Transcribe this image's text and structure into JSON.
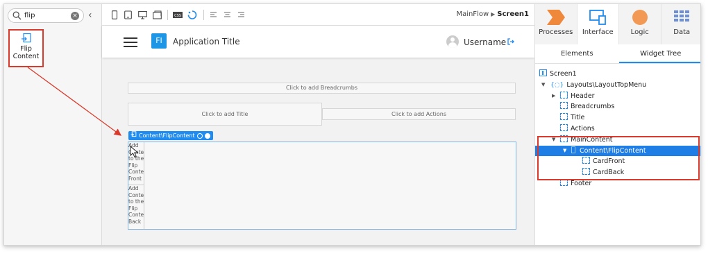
{
  "search": {
    "value": "flip"
  },
  "widget_result": {
    "label_line1": "Flip",
    "label_line2": "Content"
  },
  "toolbar": {
    "flow_name": "MainFlow",
    "screen_name": "Screen1"
  },
  "app": {
    "logo_text": "FI",
    "title": "Application Title",
    "username": "Username"
  },
  "canvas": {
    "breadcrumbs_placeholder": "Click to add Breadcrumbs",
    "title_placeholder": "Click to add Title",
    "actions_placeholder": "Click to add Actions",
    "selected_widget_tag": "Content\\FlipContent",
    "flip_front_text": "Add\nContent\nto the\nFlip\nContent\nFront",
    "flip_back_text": "Add\nContent\nto the\nFlip\nContent\nBack"
  },
  "right_tabs": [
    {
      "label": "Processes",
      "icon": "processes-icon"
    },
    {
      "label": "Interface",
      "icon": "interface-icon"
    },
    {
      "label": "Logic",
      "icon": "logic-icon"
    },
    {
      "label": "Data",
      "icon": "data-icon"
    }
  ],
  "sub_tabs": {
    "elements": "Elements",
    "widget_tree": "Widget Tree"
  },
  "tree": [
    {
      "label": "Screen1"
    },
    {
      "label": "Layouts\\LayoutTopMenu"
    },
    {
      "label": "Header"
    },
    {
      "label": "Breadcrumbs"
    },
    {
      "label": "Title"
    },
    {
      "label": "Actions"
    },
    {
      "label": "MainContent"
    },
    {
      "label": "Content\\FlipContent"
    },
    {
      "label": "CardFront"
    },
    {
      "label": "CardBack"
    },
    {
      "label": "Footer"
    }
  ],
  "colors": {
    "accent": "#1f8cf2",
    "highlight_red": "#d93a2b",
    "processes_orange": "#f0883c",
    "logic_orange": "#f29a55",
    "data_blue": "#6c8fd8"
  }
}
